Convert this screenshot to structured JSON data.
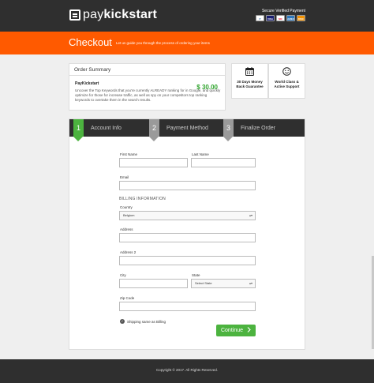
{
  "brand": {
    "logo_prefix": "pay",
    "logo_suffix": "kickstart"
  },
  "secure": {
    "label": "Secure Verified Payment",
    "cards": [
      {
        "name": "PayPal",
        "color": "#ffffff",
        "text": "P",
        "text_color": "#1d5fa8"
      },
      {
        "name": "Visa",
        "color": "#1a1f71",
        "text": "VISA",
        "text_color": "#ffffff"
      },
      {
        "name": "MasterCard",
        "color": "#ffffff",
        "text": "MC",
        "text_color": "#eb001b"
      },
      {
        "name": "American Express",
        "color": "#2e77bb",
        "text": "AMEX",
        "text_color": "#ffffff"
      },
      {
        "name": "Discover",
        "color": "#f39200",
        "text": "DISC",
        "text_color": "#ffffff"
      }
    ]
  },
  "banner": {
    "title": "Checkout",
    "subtitle": "Let us guide you through the process of ordering your items"
  },
  "order_summary": {
    "heading": "Order Summary",
    "product_name": "PayKickstart",
    "price": "$ 30.00",
    "description": "Uncover the Top Keywords that you're currently ALREADY ranking for in Google, and quickly optimize for those for increase traffic, as well as spy on your competitors top ranking keywords to overtake them in the search results."
  },
  "features": [
    {
      "icon": "calendar-icon",
      "label_line1": "30 Days Money",
      "label_line2": "Back Guarantee"
    },
    {
      "icon": "smiley-icon",
      "label_line1": "World Class &",
      "label_line2": "Active Support"
    }
  ],
  "steps": [
    {
      "num": "1",
      "label": "Account Info",
      "active": true
    },
    {
      "num": "2",
      "label": "Payment Method",
      "active": false
    },
    {
      "num": "3",
      "label": "Finalize Order",
      "active": false
    }
  ],
  "form": {
    "first_name_label": "First Name",
    "first_name_value": "",
    "last_name_label": "Last Name",
    "last_name_value": "",
    "email_label": "Email",
    "email_value": "",
    "billing_heading": "BILLING INFORMATION",
    "country_label": "Country",
    "country_value": "Belgium",
    "address_label": "Address",
    "address_value": "",
    "address2_label": "Address 2",
    "address2_value": "",
    "city_label": "City",
    "city_value": "",
    "state_label": "State",
    "state_value": "Select State",
    "zip_label": "Zip Code",
    "zip_value": "",
    "shipping_same_label": "Shipping same as Billing",
    "continue_label": "Continue"
  },
  "footer": {
    "copyright": "Copyright © 2017. All Rights Reserved."
  },
  "colors": {
    "accent": "#ff5a00",
    "success": "#4cb33f",
    "dark": "#2f2f2f"
  }
}
